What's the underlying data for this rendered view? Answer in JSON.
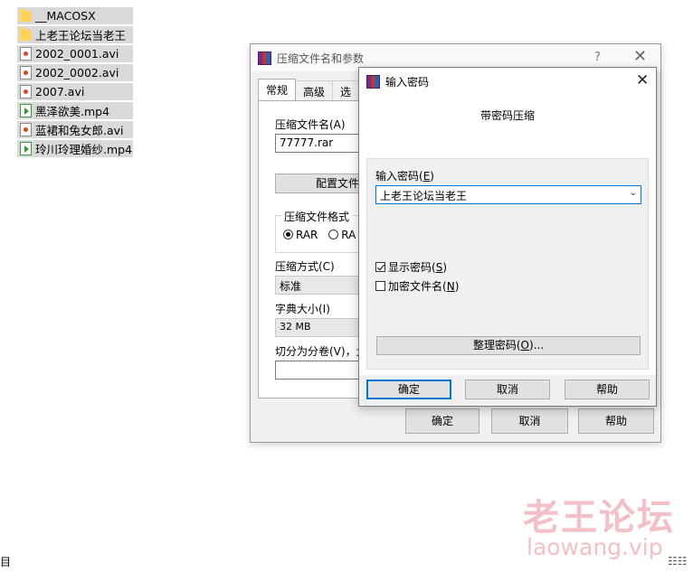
{
  "files": [
    {
      "name": "__MACOSX",
      "icon": "folder-icon"
    },
    {
      "name": "上老王论坛当老王",
      "icon": "folder-icon"
    },
    {
      "name": "2002_0001.avi",
      "icon": "video-file-icon"
    },
    {
      "name": "2002_0002.avi",
      "icon": "video-file-icon"
    },
    {
      "name": "2007.avi",
      "icon": "video-file-icon"
    },
    {
      "name": "黑泽欲美.mp4",
      "icon": "play-file-icon"
    },
    {
      "name": "蓝裙和兔女郎.avi",
      "icon": "video-file-icon"
    },
    {
      "name": "玲川玲理婚纱.mp4",
      "icon": "play-file-icon"
    }
  ],
  "archive_dialog": {
    "title": "压缩文件名和参数",
    "help": "?",
    "close": "✕",
    "tabs": [
      "常规",
      "高级",
      "选"
    ],
    "filename_label": "压缩文件名(A)",
    "filename_value": "77777.rar",
    "profile_button": "配置文件",
    "format_group": "压缩文件格式",
    "format_rar": "RAR",
    "format_rar_partial": "RA",
    "method_label": "压缩方式(C)",
    "method_value": "标准",
    "dict_label": "字典大小(I)",
    "dict_value": "32 MB",
    "split_label": "切分为分卷(V)，大",
    "ok": "确定",
    "cancel": "取消",
    "help_button": "帮助"
  },
  "password_dialog": {
    "title": "输入密码",
    "close": "✕",
    "heading": "带密码压缩",
    "enter_label": "输入密码",
    "enter_key": "E",
    "password_value": "上老王论坛当老王",
    "show_password": "显示密码",
    "show_key": "S",
    "show_checked": true,
    "encrypt_names": "加密文件名",
    "encrypt_key": "N",
    "encrypt_checked": false,
    "organize_label": "整理密码",
    "organize_key": "O",
    "organize_suffix": "...",
    "ok": "确定",
    "cancel": "取消",
    "help": "帮助"
  },
  "watermark": {
    "cn": "老王论坛",
    "en": "laowang.vip"
  },
  "edge": {
    "left": "目",
    "right": "☷☷"
  },
  "colors": {
    "accent": "#0078d7",
    "watermark": "#f2c0c6",
    "file_highlight": "#d9d9d9"
  }
}
